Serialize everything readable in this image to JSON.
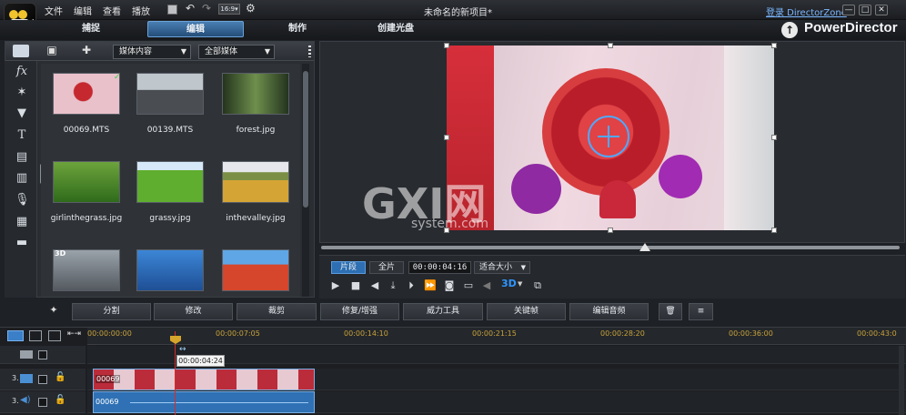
{
  "window": {
    "title": "未命名的新项目*",
    "login_label": "登录 DirectorZone",
    "minimize": "—",
    "maximize": "□",
    "close": "✕"
  },
  "menu": [
    "文件",
    "编辑",
    "查看",
    "播放"
  ],
  "tabs": [
    {
      "label": "捕捉",
      "active": false
    },
    {
      "label": "编辑",
      "active": true
    },
    {
      "label": "制作",
      "active": false
    },
    {
      "label": "创建光盘",
      "active": false
    }
  ],
  "brand": {
    "label": "PowerDirector"
  },
  "library": {
    "content_dropdown": "媒体内容",
    "filter_dropdown": "全部媒体",
    "items": [
      {
        "name": "00069.MTS",
        "badge": "✓"
      },
      {
        "name": "00139.MTS",
        "badge": ""
      },
      {
        "name": "forest.jpg",
        "badge": ""
      },
      {
        "name": "girlinthegrass.jpg",
        "badge": ""
      },
      {
        "name": "grassy.jpg",
        "badge": ""
      },
      {
        "name": "inthevalley.jpg",
        "badge": ""
      },
      {
        "name": "",
        "badge": "3D"
      },
      {
        "name": "",
        "badge": ""
      },
      {
        "name": "",
        "badge": ""
      }
    ]
  },
  "preview": {
    "watermark": "GXI网",
    "watermark_sub": "system.com",
    "mode_clip": "片段",
    "mode_full": "全片",
    "timecode": "00:00:04:16",
    "fit_label": "适合大小",
    "three_d": "3D",
    "scrub_value": 0.56
  },
  "toolbar": {
    "split": "分割",
    "modify": "修改",
    "trim": "裁剪",
    "fix": "修复/增强",
    "power": "威力工具",
    "keyframe": "关键帧",
    "edit_audio": "编辑音频"
  },
  "timeline": {
    "ticks": [
      "00:00:00:00",
      "00:00:07:05",
      "00:00:14:10",
      "00:00:21:15",
      "00:00:28:20",
      "00:00:36:00",
      "00:00:43:0"
    ],
    "tooltip": "00:00:04:24",
    "track1_num": "3.",
    "track2_num": "3.",
    "clip_video": "00069",
    "clip_audio": "00069"
  },
  "colors": {
    "accent": "#2f71b4",
    "playhead": "#d12d2d",
    "tick": "#c8a23b"
  }
}
